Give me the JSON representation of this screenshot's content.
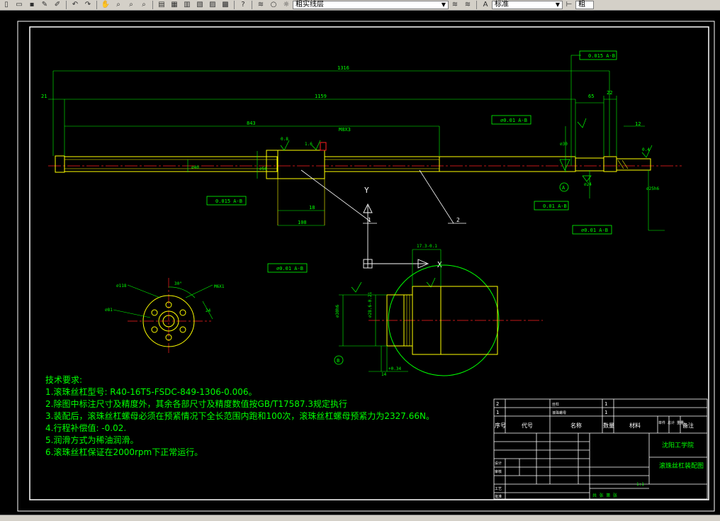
{
  "toolbar": {
    "layer_combo": "粗实线层",
    "style_combo": "标准",
    "right_combo": "粗"
  },
  "drawing": {
    "dims": {
      "total_length": "1316",
      "left_end": "21",
      "thread_length": "1159",
      "nut_offset": "843",
      "right_seg": "65",
      "right_end": "22",
      "right_small": "12",
      "nut_len": "108",
      "nut_flange": "18",
      "nut_thread": "M8X3",
      "dia_40": "⌀40",
      "dia_56": "⌀56",
      "dia_30": "⌀30",
      "dia_25": "⌀25h6",
      "dia_24": "⌀24",
      "rough_08": "0.8",
      "rough_16": "1.6",
      "rough_04": "0.4",
      "detail_width": "17.3-0.1",
      "detail_dia": "⌀30h6",
      "detail_dia2": "⌀28.6-0.21",
      "detail_tol": "+0.34",
      "detail_len": "14",
      "flange_dia": "⌀118",
      "flange_dia2": "⌀81",
      "flange_angle": "30°",
      "flange_thread": "M6X1",
      "flange_val": "24"
    },
    "tolerances": {
      "tol_top": "0.015 A-B",
      "tol_mid": "⌀0.01 A-B",
      "tol_left": "0.015 A-B",
      "tol_right1": "0.01 A-B",
      "tol_right2": "⌀0.01 A-B",
      "tol_detail": "⌀0.01 A-B"
    },
    "datum_a": "A",
    "datum_b": "B",
    "leader_1": "1",
    "leader_2": "2",
    "ucs_y": "Y",
    "ucs_x": "X"
  },
  "notes": {
    "heading": "技术要求:",
    "lines": [
      "1.滚珠丝杠型号: R40-16T5-FSDC-849-1306-0.006。",
      "2.除图中标注尺寸及精度外，其余各部尺寸及精度数值按GB/T17587.3规定执行",
      "3.装配后，滚珠丝杠螺母必须在预紧情况下全长范围内跑和100次，滚珠丝杠螺母预紧力为2327.66N。",
      "4.行程补偿值: -0.02.",
      "5.润滑方式为稀油润滑。",
      "6.滚珠丝杠保证在2000rpm下正常运行。"
    ]
  },
  "title_block": {
    "row2_no": "2",
    "row1_no": "1",
    "row2_name": "丝杠",
    "row1_name": "滚珠螺母",
    "row2_qty": "1",
    "row1_qty": "1",
    "hdr_no": "序号",
    "hdr_code": "代号",
    "hdr_name": "名称",
    "hdr_qty": "数量",
    "hdr_material": "材料",
    "hdr_weight": "单件 总计 重量",
    "hdr_remark": "备注",
    "school": "沈阳工学院",
    "drawing_name": "滚珠丝杠装配图",
    "scale": "1:1",
    "sheet_info": "共 张 第 张",
    "designer": "设计",
    "checker": "审核",
    "process": "工艺",
    "approve": "批准"
  }
}
